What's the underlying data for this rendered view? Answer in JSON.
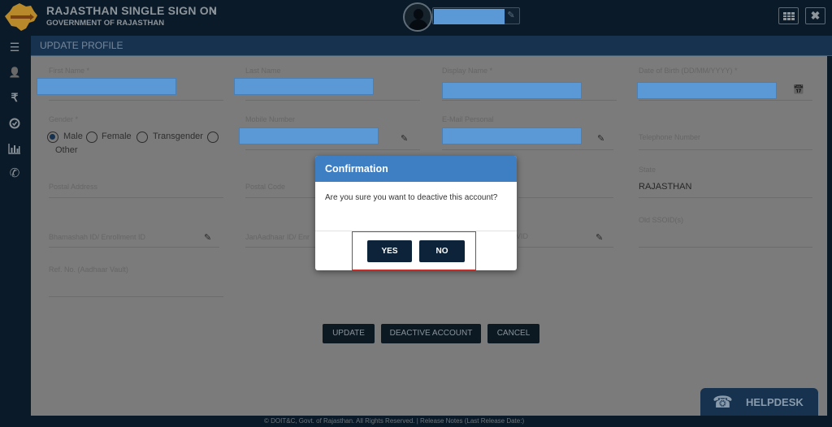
{
  "header": {
    "title": "RAJASTHAN SINGLE SIGN ON",
    "caret": "v",
    "subtitle": "GOVERNMENT OF RAJASTHAN",
    "user_name_redacted": "",
    "edit_icon": "✎",
    "apps_icon": "grid-icon",
    "close_icon": "✖"
  },
  "sidebar": {
    "items": [
      {
        "name": "dashboard",
        "glyph": "☰"
      },
      {
        "name": "profile",
        "glyph": "👤"
      },
      {
        "name": "payments",
        "glyph": "₹"
      },
      {
        "name": "approvals",
        "glyph": "✓"
      },
      {
        "name": "reports",
        "glyph": "📊"
      },
      {
        "name": "contact",
        "glyph": "✆"
      }
    ]
  },
  "panel": {
    "title": "UPDATE PROFILE"
  },
  "form": {
    "first_name_label": "First Name *",
    "last_name_label": "Last Name",
    "display_name_label": "Display Name *",
    "dob_label": "Date of Birth (DD/MM/YYYY) *",
    "gender_label": "Gender *",
    "gender_options": [
      "Male",
      "Female",
      "Transgender",
      "Other"
    ],
    "gender_selected": "Male",
    "mobile_label": "Mobile Number",
    "email_label": "E-Mail Personal",
    "telephone_label": "Telephone Number",
    "postal_address_label": "Postal Address",
    "postal_code_label": "Postal Code",
    "state_label": "State",
    "state_value": "RAJASTHAN",
    "old_ssoid_label": "Old SSOID(s)",
    "bhamashah_label": "Bhamashah ID/ Enrollment ID",
    "janaadhaar_label": "JanAadhaar ID/ Enr",
    "vid_label": "VID",
    "ref_no_label": "Ref. No. (Aadhaar Vault)",
    "calendar_icon": "📅",
    "edit_icon": "✎"
  },
  "actions": {
    "update": "UPDATE",
    "deactivate": "DEACTIVE ACCOUNT",
    "cancel": "CANCEL"
  },
  "modal": {
    "title": "Confirmation",
    "message": "Are you sure you want to deactive this account?",
    "yes": "YES",
    "no": "NO"
  },
  "helpdesk": {
    "label": "HELPDESK",
    "icon": "☎"
  },
  "footer": {
    "text": "© DOIT&C, Govt. of Rajasthan. All Rights Reserved.  |  Release Notes (Last Release Date:)"
  }
}
